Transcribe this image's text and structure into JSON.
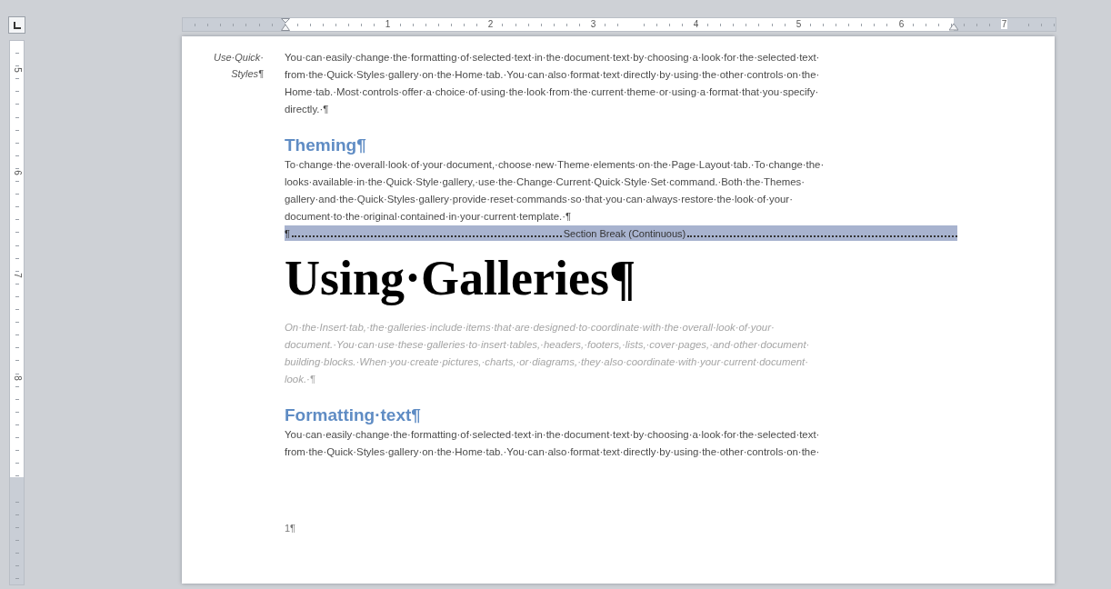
{
  "horizontal_ruler": {
    "numbers": [
      "1",
      "2",
      "3",
      "4",
      "5",
      "6",
      "7"
    ]
  },
  "vertical_ruler": {
    "numbers": [
      "5",
      "6",
      "7",
      "8"
    ]
  },
  "page": {
    "margin_note": {
      "lines": [
        "Use·Quick·",
        "Styles¶"
      ]
    },
    "blocks": [
      {
        "kind": "body",
        "lines": [
          "You·can·easily·change·the·formatting·of·selected·text·in·the·document·text·by·choosing·a·look·for·the·selected·text·",
          "from·the·Quick·Styles·gallery·on·the·Home·tab.·You·can·also·format·text·directly·by·using·the·other·controls·on·the·",
          "Home·tab.·Most·controls·offer·a·choice·of·using·the·look·from·the·current·theme·or·using·a·format·that·you·specify·",
          "directly.·¶"
        ]
      },
      {
        "kind": "heading",
        "text": "Theming¶"
      },
      {
        "kind": "body",
        "lines": [
          "To·change·the·overall·look·of·your·document,·choose·new·Theme·elements·on·the·Page·Layout·tab.·To·change·the·",
          "looks·available·in·the·Quick·Style·gallery,·use·the·Change·Current·Quick·Style·Set·command.·Both·the·Themes·",
          "gallery·and·the·Quick·Styles·gallery·provide·reset·commands·so·that·you·can·always·restore·the·look·of·your·",
          "document·to·the·original·contained·in·your·current·template.·¶"
        ]
      },
      {
        "kind": "section_break",
        "mark": "¶",
        "label": "Section Break (Continuous)"
      },
      {
        "kind": "title",
        "text": "Using·Galleries¶"
      },
      {
        "kind": "muted",
        "lines": [
          "On·the·Insert·tab,·the·galleries·include·items·that·are·designed·to·coordinate·with·the·overall·look·of·your·",
          "document.·You·can·use·these·galleries·to·insert·tables,·headers,·footers,·lists,·cover·pages,·and·other·document·",
          "building·blocks.·When·you·create·pictures,·charts,·or·diagrams,·they·also·coordinate·with·your·current·document·",
          "look.·¶"
        ]
      },
      {
        "kind": "heading",
        "text": "Formatting·text¶"
      },
      {
        "kind": "body",
        "lines": [
          "You·can·easily·change·the·formatting·of·selected·text·in·the·document·text·by·choosing·a·look·for·the·selected·text·",
          "from·the·Quick·Styles·gallery·on·the·Home·tab.·You·can·also·format·text·directly·by·using·the·other·controls·on·the·"
        ]
      }
    ],
    "page_number": "1¶"
  }
}
